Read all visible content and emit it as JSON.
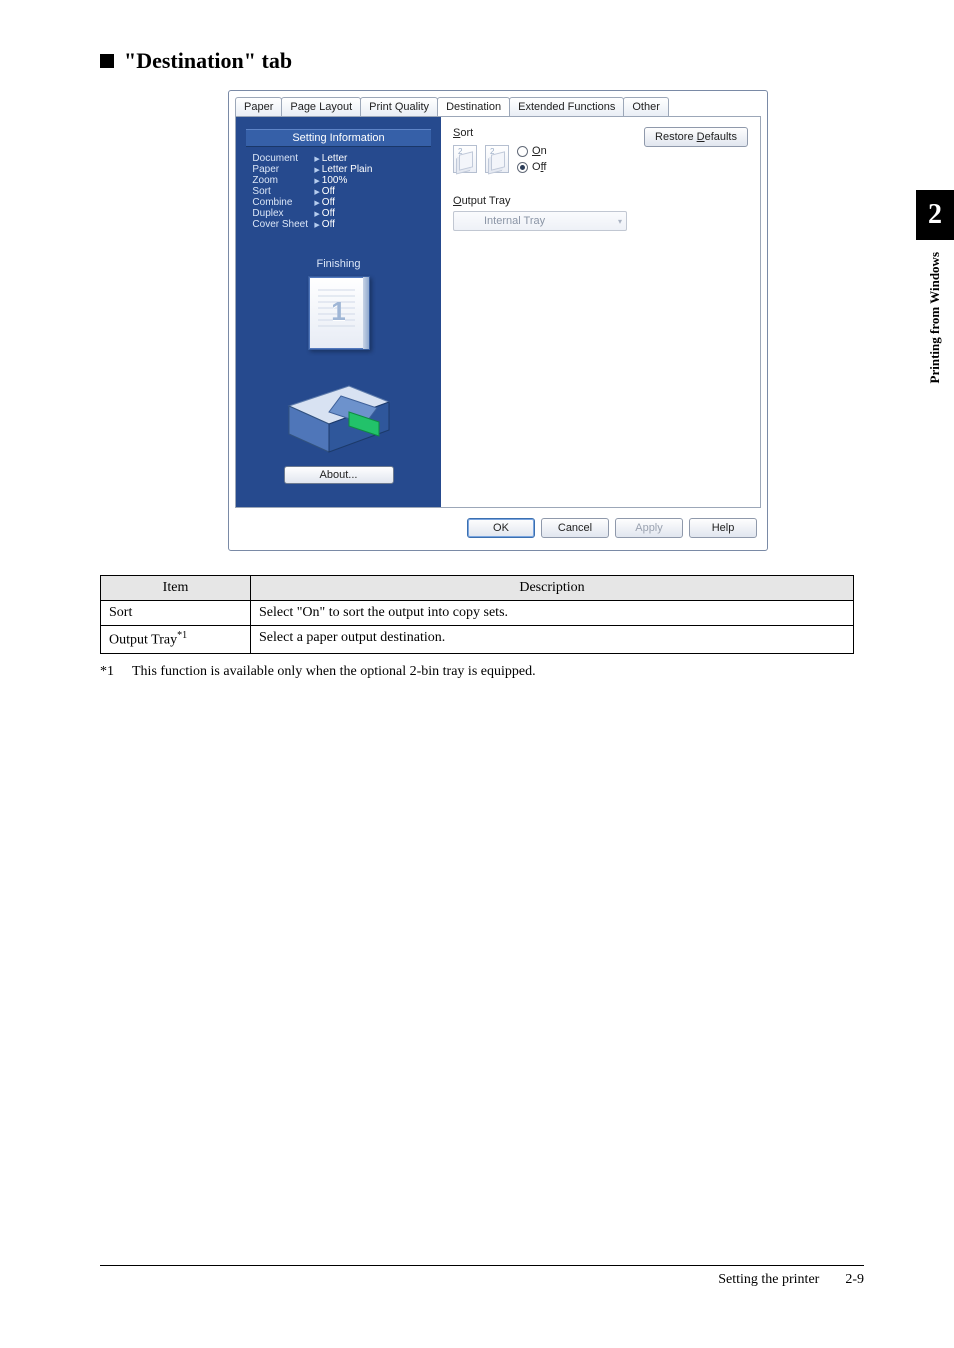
{
  "heading": "\"Destination\" tab",
  "side_tab": {
    "number": "2",
    "label": "Printing from Windows"
  },
  "dialog": {
    "tabs": [
      "Paper",
      "Page Layout",
      "Print Quality",
      "Destination",
      "Extended Functions",
      "Other"
    ],
    "active_tab_index": 3,
    "sidebar": {
      "header": "Setting Information",
      "rows": [
        {
          "k": "Document",
          "v": "Letter"
        },
        {
          "k": "Paper",
          "v": "Letter Plain"
        },
        {
          "k": "Zoom",
          "v": "100%"
        },
        {
          "k": "Sort",
          "v": "Off"
        },
        {
          "k": "Combine",
          "v": "Off"
        },
        {
          "k": "Duplex",
          "v": "Off"
        },
        {
          "k": "Cover Sheet",
          "v": "Off"
        }
      ],
      "finishing_label": "Finishing",
      "preview_number": "1",
      "about_label": "About..."
    },
    "main": {
      "sort_label_prefix": "S",
      "sort_label_rest": "ort",
      "sort_on_prefix": "O",
      "sort_on_rest": "n",
      "sort_off_label": "Off",
      "sort_off_underline": "f",
      "restore_prefix": "Restore ",
      "restore_under": "D",
      "restore_rest": "efaults",
      "output_prefix": "O",
      "output_rest": "utput Tray",
      "output_value": "Internal Tray"
    },
    "buttons": {
      "ok": "OK",
      "cancel": "Cancel",
      "apply": "Apply",
      "help": "Help"
    }
  },
  "table": {
    "head_item": "Item",
    "head_desc": "Description",
    "rows": [
      {
        "item": "Sort",
        "sup": "",
        "desc": "Select \"On\" to sort the output into copy sets."
      },
      {
        "item": "Output Tray",
        "sup": "*1",
        "desc": "Select a paper output destination."
      }
    ]
  },
  "footnote": {
    "mark": "*1",
    "text": "This function is available only when the optional 2-bin tray is equipped."
  },
  "footer": {
    "section": "Setting the printer",
    "page": "2-9"
  }
}
